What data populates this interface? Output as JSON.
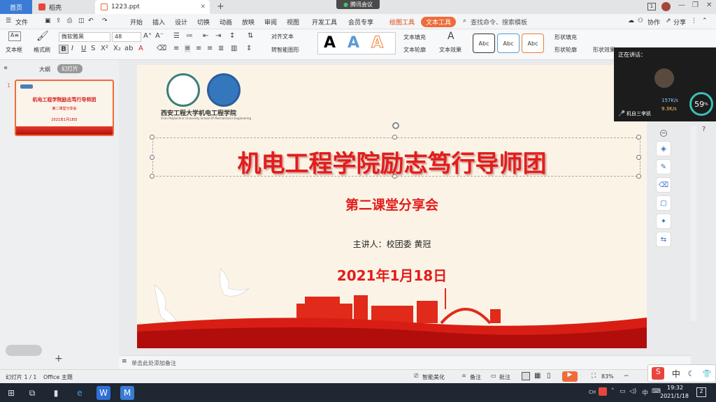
{
  "tabs": {
    "home": "首页",
    "docer": "稻壳",
    "file": "1223.ppt"
  },
  "meeting": {
    "label": "腾讯会议"
  },
  "menu": {
    "file": "文件",
    "items": [
      "开始",
      "插入",
      "设计",
      "切换",
      "动画",
      "放映",
      "审阅",
      "视图",
      "开发工具",
      "会员专享"
    ],
    "draw_tool": "绘图工具",
    "text_tool": "文本工具",
    "search_placeholder": "查找命令、搜索模板",
    "collab": "协作",
    "share": "分享"
  },
  "ribbon": {
    "textbox": "文本框",
    "format_painter": "格式刷",
    "font": "微软雅黑",
    "size": "48",
    "align_text": "对齐文本",
    "smart_shape": "转智能图形",
    "text_fill": "文本填充",
    "text_outline": "文本轮廓",
    "text_effect": "文本效果",
    "shape_fill": "形状填充",
    "shape_outline": "形状轮廓",
    "shape_effect": "形状效果",
    "style_samples": [
      "Abc",
      "Abc",
      "Abc"
    ],
    "big_a": [
      "A",
      "A",
      "A"
    ]
  },
  "leftpanel": {
    "outline_tab": "大纲",
    "slides_tab": "幻灯片",
    "slide_number": "1"
  },
  "slide": {
    "logo_text": "西安工程大学机电工程学院",
    "logo_sub": "Xi'an Polytechnic University School Of Mechatronics Engineering",
    "title": "机电工程学院励志笃行导师团",
    "subtitle": "第二课堂分享会",
    "speaker": "主讲人：校团委 黄冠",
    "date": "2021年1月18日"
  },
  "thumb": {
    "title": "机电工程学院励志笃行导师团",
    "subtitle": "第二课堂分享会",
    "date": "2021年1月18日"
  },
  "video": {
    "speaking_label": "正在讲话：",
    "upload": "157K/s",
    "download": "9.3K/s",
    "percent": "59",
    "unit": "%",
    "speaker": "机自三李凯"
  },
  "notes": {
    "placeholder": "单击此处添加备注"
  },
  "status": {
    "slide_info": "幻灯片 1 / 1",
    "theme": "Office 主题",
    "beautify": "智能美化",
    "notes": "备注",
    "comments": "批注",
    "zoom": "83%"
  },
  "ime": {
    "zh": "中"
  },
  "taskbar": {
    "time": "19:32",
    "date": "2021/1/18",
    "lang": "CH",
    "notif": "2"
  }
}
